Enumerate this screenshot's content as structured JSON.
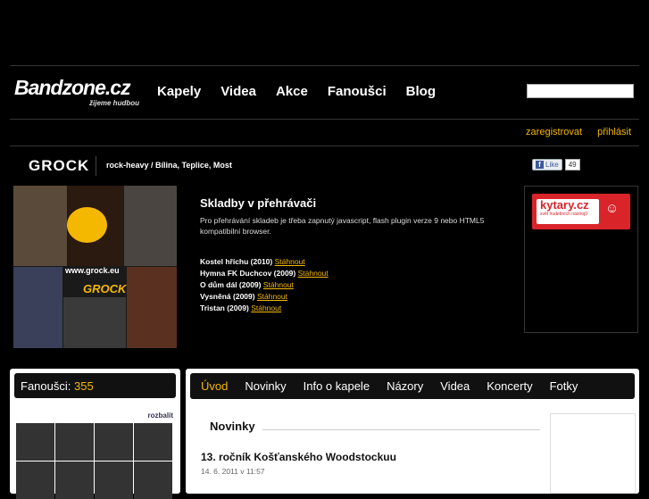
{
  "logo": {
    "text": "Bandzone.cz",
    "tagline": "žijeme hudbou"
  },
  "nav": [
    "Kapely",
    "Videa",
    "Akce",
    "Fanoušci",
    "Blog"
  ],
  "search": {
    "placeholder": ""
  },
  "user_links": {
    "register": "zaregistrovat",
    "login": "přihlásit"
  },
  "band": {
    "name": "GROCK",
    "genre": "rock-heavy / Bílina, Teplice, Most"
  },
  "facebook": {
    "like": "Like",
    "count": "49"
  },
  "photo": {
    "site": "www.grock.eu",
    "brand": "GROCK"
  },
  "player": {
    "title": "Skladby v přehrávači",
    "note": "Pro přehrávání skladeb je třeba zapnutý javascript, flash plugin verze 9 nebo HTML5 kompatibilní browser.",
    "download_label": "Stáhnout",
    "tracks": [
      {
        "title": "Kostel hříchu (2010)"
      },
      {
        "title": "Hymna FK Duchcov (2009)"
      },
      {
        "title": "O dům dál (2009)"
      },
      {
        "title": "Vysněná (2009)"
      },
      {
        "title": "Tristan (2009)"
      }
    ]
  },
  "ad": {
    "name": "kytary.cz",
    "sub": "svět hudebních nástrojů",
    "smile": "☺"
  },
  "fans": {
    "label": "Fanoušci:",
    "count": "355",
    "expand": "rozbalit"
  },
  "tabs": [
    "Úvod",
    "Novinky",
    "Info o kapele",
    "Názory",
    "Videa",
    "Koncerty",
    "Fotky"
  ],
  "news": {
    "heading": "Novinky",
    "item_title": "13. ročník Košťanského Woodstockuu",
    "item_date": "14. 6. 2011 v 11:57"
  },
  "colors": {
    "accent": "#f5b800",
    "background": "#000000"
  }
}
